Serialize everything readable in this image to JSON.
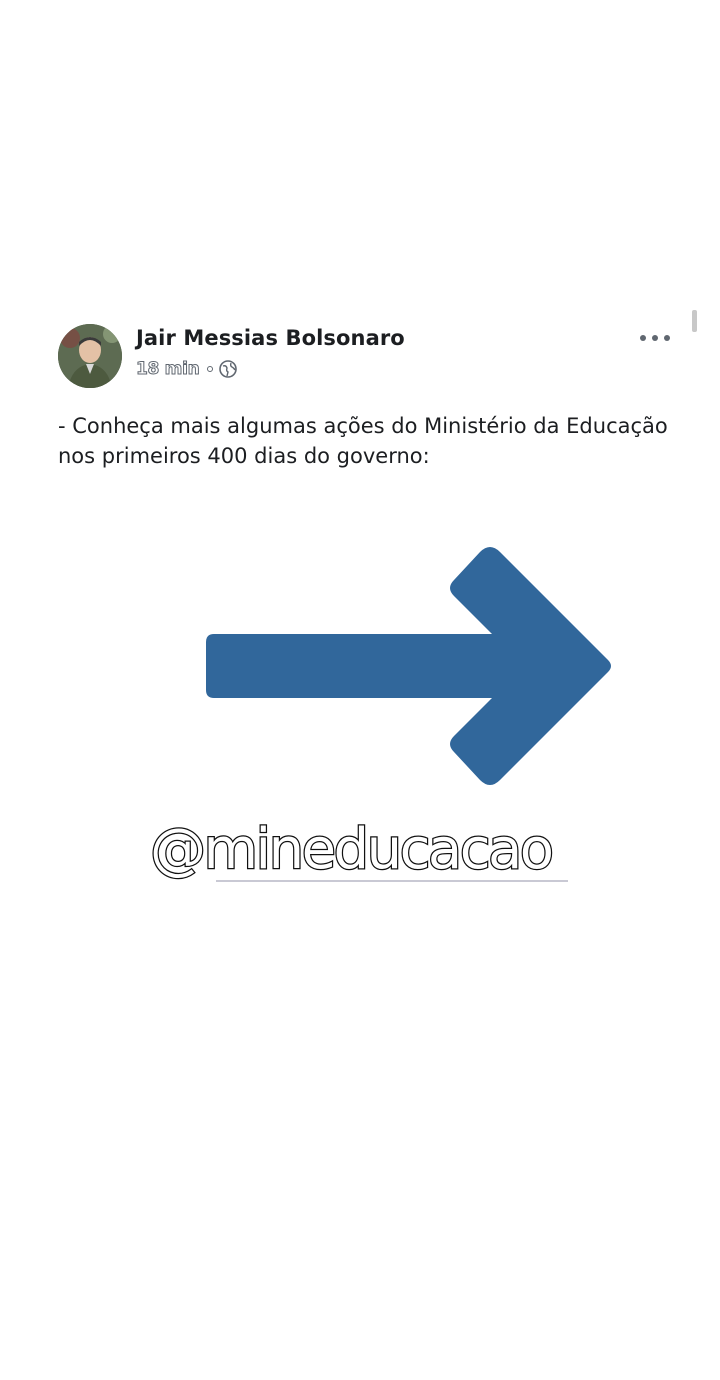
{
  "post": {
    "author_name": "Jair Messias Bolsonaro",
    "timestamp": "18 min",
    "privacy_icon": "globe-icon",
    "more_icon": "more-options-icon",
    "text_line_1": "- Conheça mais algumas ações do Ministério da Educação",
    "text_line_2": "nos primeiros 400 dias do governo:"
  },
  "graphic": {
    "arrow_color": "#31679b",
    "handle": "@mineducacao"
  }
}
